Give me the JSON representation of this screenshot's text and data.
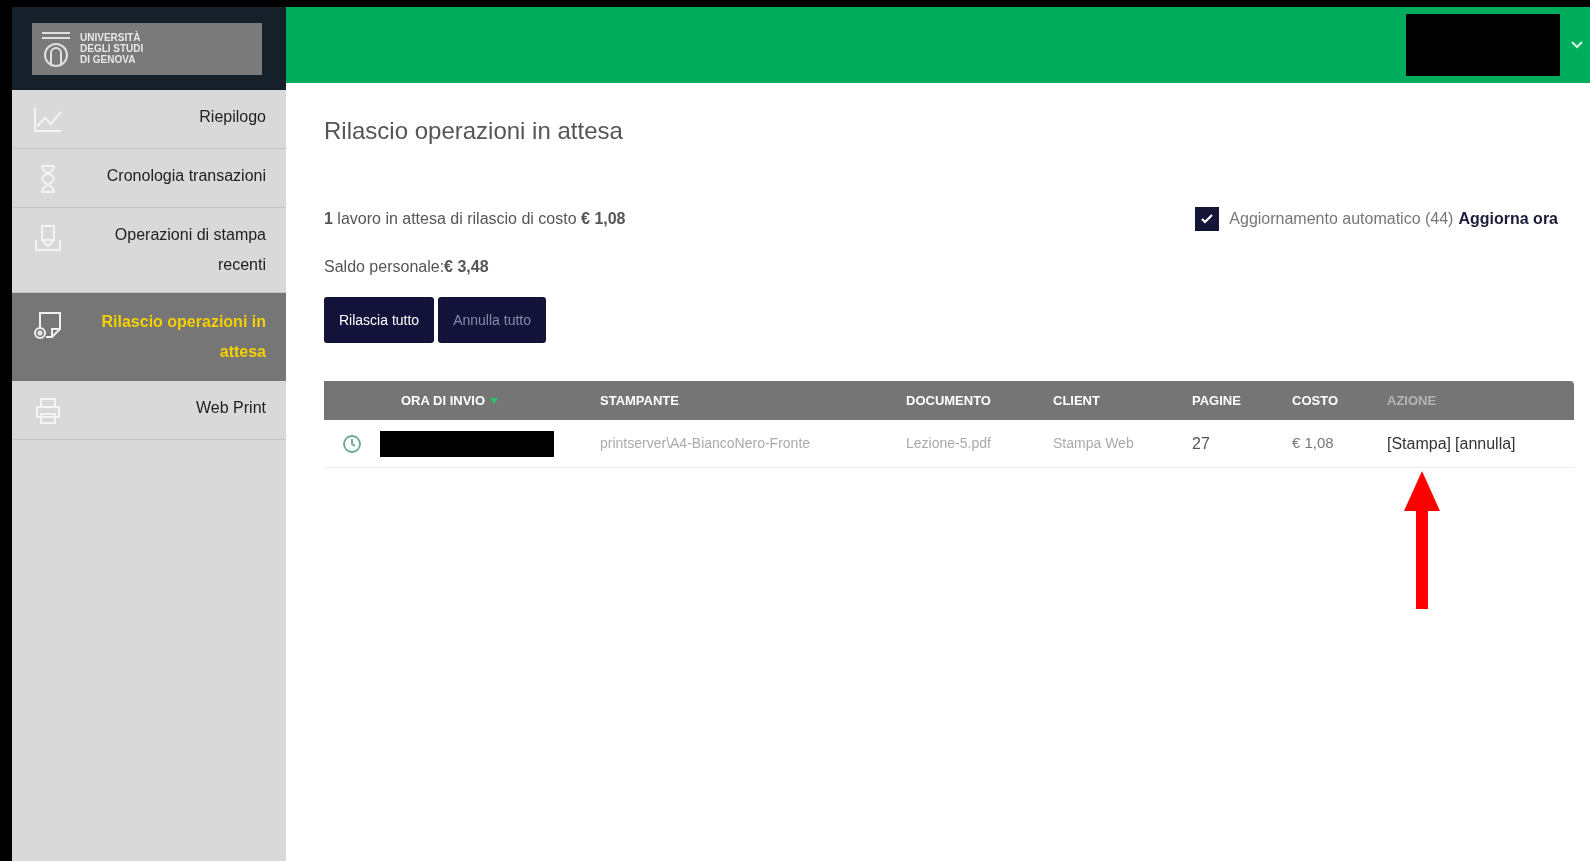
{
  "logo": {
    "lines": [
      "UNIVERSITÀ",
      "DEGLI STUDI",
      "DI GENOVA"
    ]
  },
  "sidebar": {
    "items": [
      {
        "label": "Riepilogo",
        "selected": false
      },
      {
        "label": "Cronologia transazioni",
        "selected": false
      },
      {
        "label": "Operazioni di stampa recenti",
        "selected": false
      },
      {
        "label": "Rilascio operazioni in attesa",
        "selected": true
      },
      {
        "label": "Web Print",
        "selected": false
      }
    ]
  },
  "page_title": "Rilascio operazioni in attesa",
  "summary": "**1** lavoro in attesa di rilascio di costo **€ 1,08**",
  "balance": "Saldo personale:**€ 3,48**",
  "auto_refresh": {
    "label": "Aggiornamento automatico (44)",
    "checked": true,
    "link": "Aggiorna ora"
  },
  "buttons": [
    {
      "label": "Rilascia tutto",
      "disabled": false
    },
    {
      "label": "Annulla tutto",
      "disabled": true
    }
  ],
  "table": {
    "columns": [
      {
        "label": "ORA DI INVIO",
        "sorted": true,
        "dim": false
      },
      {
        "label": "STAMPANTE",
        "sorted": false,
        "dim": false
      },
      {
        "label": "DOCUMENTO",
        "sorted": false,
        "dim": false
      },
      {
        "label": "CLIENT",
        "sorted": false,
        "dim": false
      },
      {
        "label": "PAGINE",
        "sorted": false,
        "dim": false
      },
      {
        "label": "COSTO",
        "sorted": false,
        "dim": false
      },
      {
        "label": "AZIONE",
        "sorted": false,
        "dim": true
      }
    ],
    "rows": [
      {
        "printer": "printserver\\A4-BiancoNero-Fronte",
        "document": "Lezione-5.pdf",
        "client": "Stampa Web",
        "pages": "27",
        "cost": "€ 1,08",
        "actions": [
          "[Stampa]",
          "[annulla]"
        ]
      }
    ]
  }
}
